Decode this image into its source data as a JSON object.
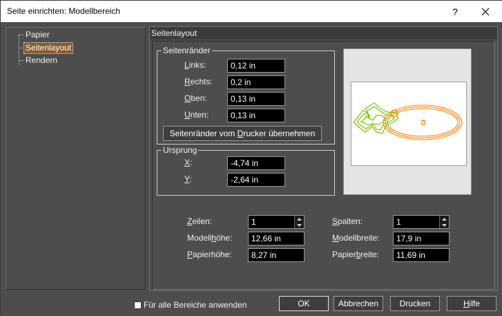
{
  "window": {
    "title": "Seite einrichten: Modellbereich",
    "help_label": "?",
    "close_icon": "close-icon"
  },
  "tree": {
    "items": [
      {
        "label": "Papier",
        "selected": false
      },
      {
        "label": "Seitenlayout",
        "selected": true
      },
      {
        "label": "Rendern",
        "selected": false
      }
    ]
  },
  "panel": {
    "header": "Seitenlayout"
  },
  "margins": {
    "group_title": "Seitenränder",
    "left": {
      "label_ul": "L",
      "label_rest": "inks:",
      "value": "0,12 in"
    },
    "right": {
      "label_ul": "R",
      "label_rest": "echts:",
      "value": "0,2 in"
    },
    "top": {
      "label_ul": "O",
      "label_rest": "ben:",
      "value": "0,13 in"
    },
    "bottom": {
      "label_ul": "U",
      "label_rest": "nten:",
      "value": "0,13 in"
    },
    "from_printer": {
      "pre": "Seitenränder vom ",
      "ul": "D",
      "post": "rucker übernehmen"
    }
  },
  "origin": {
    "group_title": "Ursprung",
    "x": {
      "label_ul": "X",
      "label_rest": ":",
      "value": "-4,74 in"
    },
    "y": {
      "label_ul": "Y",
      "label_rest": ":",
      "value": "-2,64 in"
    }
  },
  "layout": {
    "rows": {
      "label_ul": "Z",
      "label_rest": "eilen:",
      "value": "1"
    },
    "columns": {
      "label_ul": "S",
      "label_rest": "palten:",
      "value": "1"
    },
    "model_height": {
      "label_pre": "Modell",
      "label_ul": "h",
      "label_rest": "öhe:",
      "value": "12,66 in"
    },
    "model_width": {
      "label_pre": "",
      "label_ul": "M",
      "label_rest": "odellbreite:",
      "value": "17,9 in"
    },
    "paper_height": {
      "label_pre": "",
      "label_ul": "P",
      "label_rest": "apierhöhe:",
      "value": "8,27 in"
    },
    "paper_width": {
      "label_pre": "Papier",
      "label_ul": "b",
      "label_rest": "reite:",
      "value": "11,69 in"
    }
  },
  "footer": {
    "apply_all": "Für alle Bereiche anwenden",
    "ok": "OK",
    "cancel": "Abbrechen",
    "print": "Drucken",
    "help": {
      "ul": "H",
      "rest": "ilfe"
    }
  },
  "colors": {
    "accent_selected": "#8a5a2b",
    "preview_orange": "#ff8000",
    "preview_green": "#80c000"
  }
}
